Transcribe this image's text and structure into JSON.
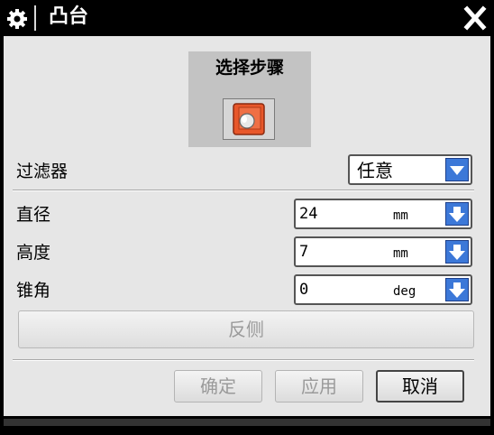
{
  "window": {
    "title": "凸台",
    "icon": "gear-icon",
    "close_icon": "close-icon"
  },
  "selection_step": {
    "label": "选择步骤",
    "icon": "boss-face-select-icon"
  },
  "filter": {
    "label": "过滤器",
    "value": "任意"
  },
  "parameters": [
    {
      "label": "直径",
      "value": "24",
      "unit": "mm"
    },
    {
      "label": "高度",
      "value": "7",
      "unit": "mm"
    },
    {
      "label": "锥角",
      "value": "0",
      "unit": "deg"
    }
  ],
  "flip_button": {
    "label": "反侧",
    "enabled": false
  },
  "buttons": {
    "ok": {
      "label": "确定",
      "enabled": false
    },
    "apply": {
      "label": "应用",
      "enabled": false
    },
    "cancel": {
      "label": "取消",
      "enabled": true
    }
  },
  "colors": {
    "titlebar": "#000000",
    "client_bg": "#e6e6e6",
    "dropdown_button": "#3c78d8",
    "step_icon_accent": "#e8572a",
    "disabled_text": "#9a9a9a"
  }
}
